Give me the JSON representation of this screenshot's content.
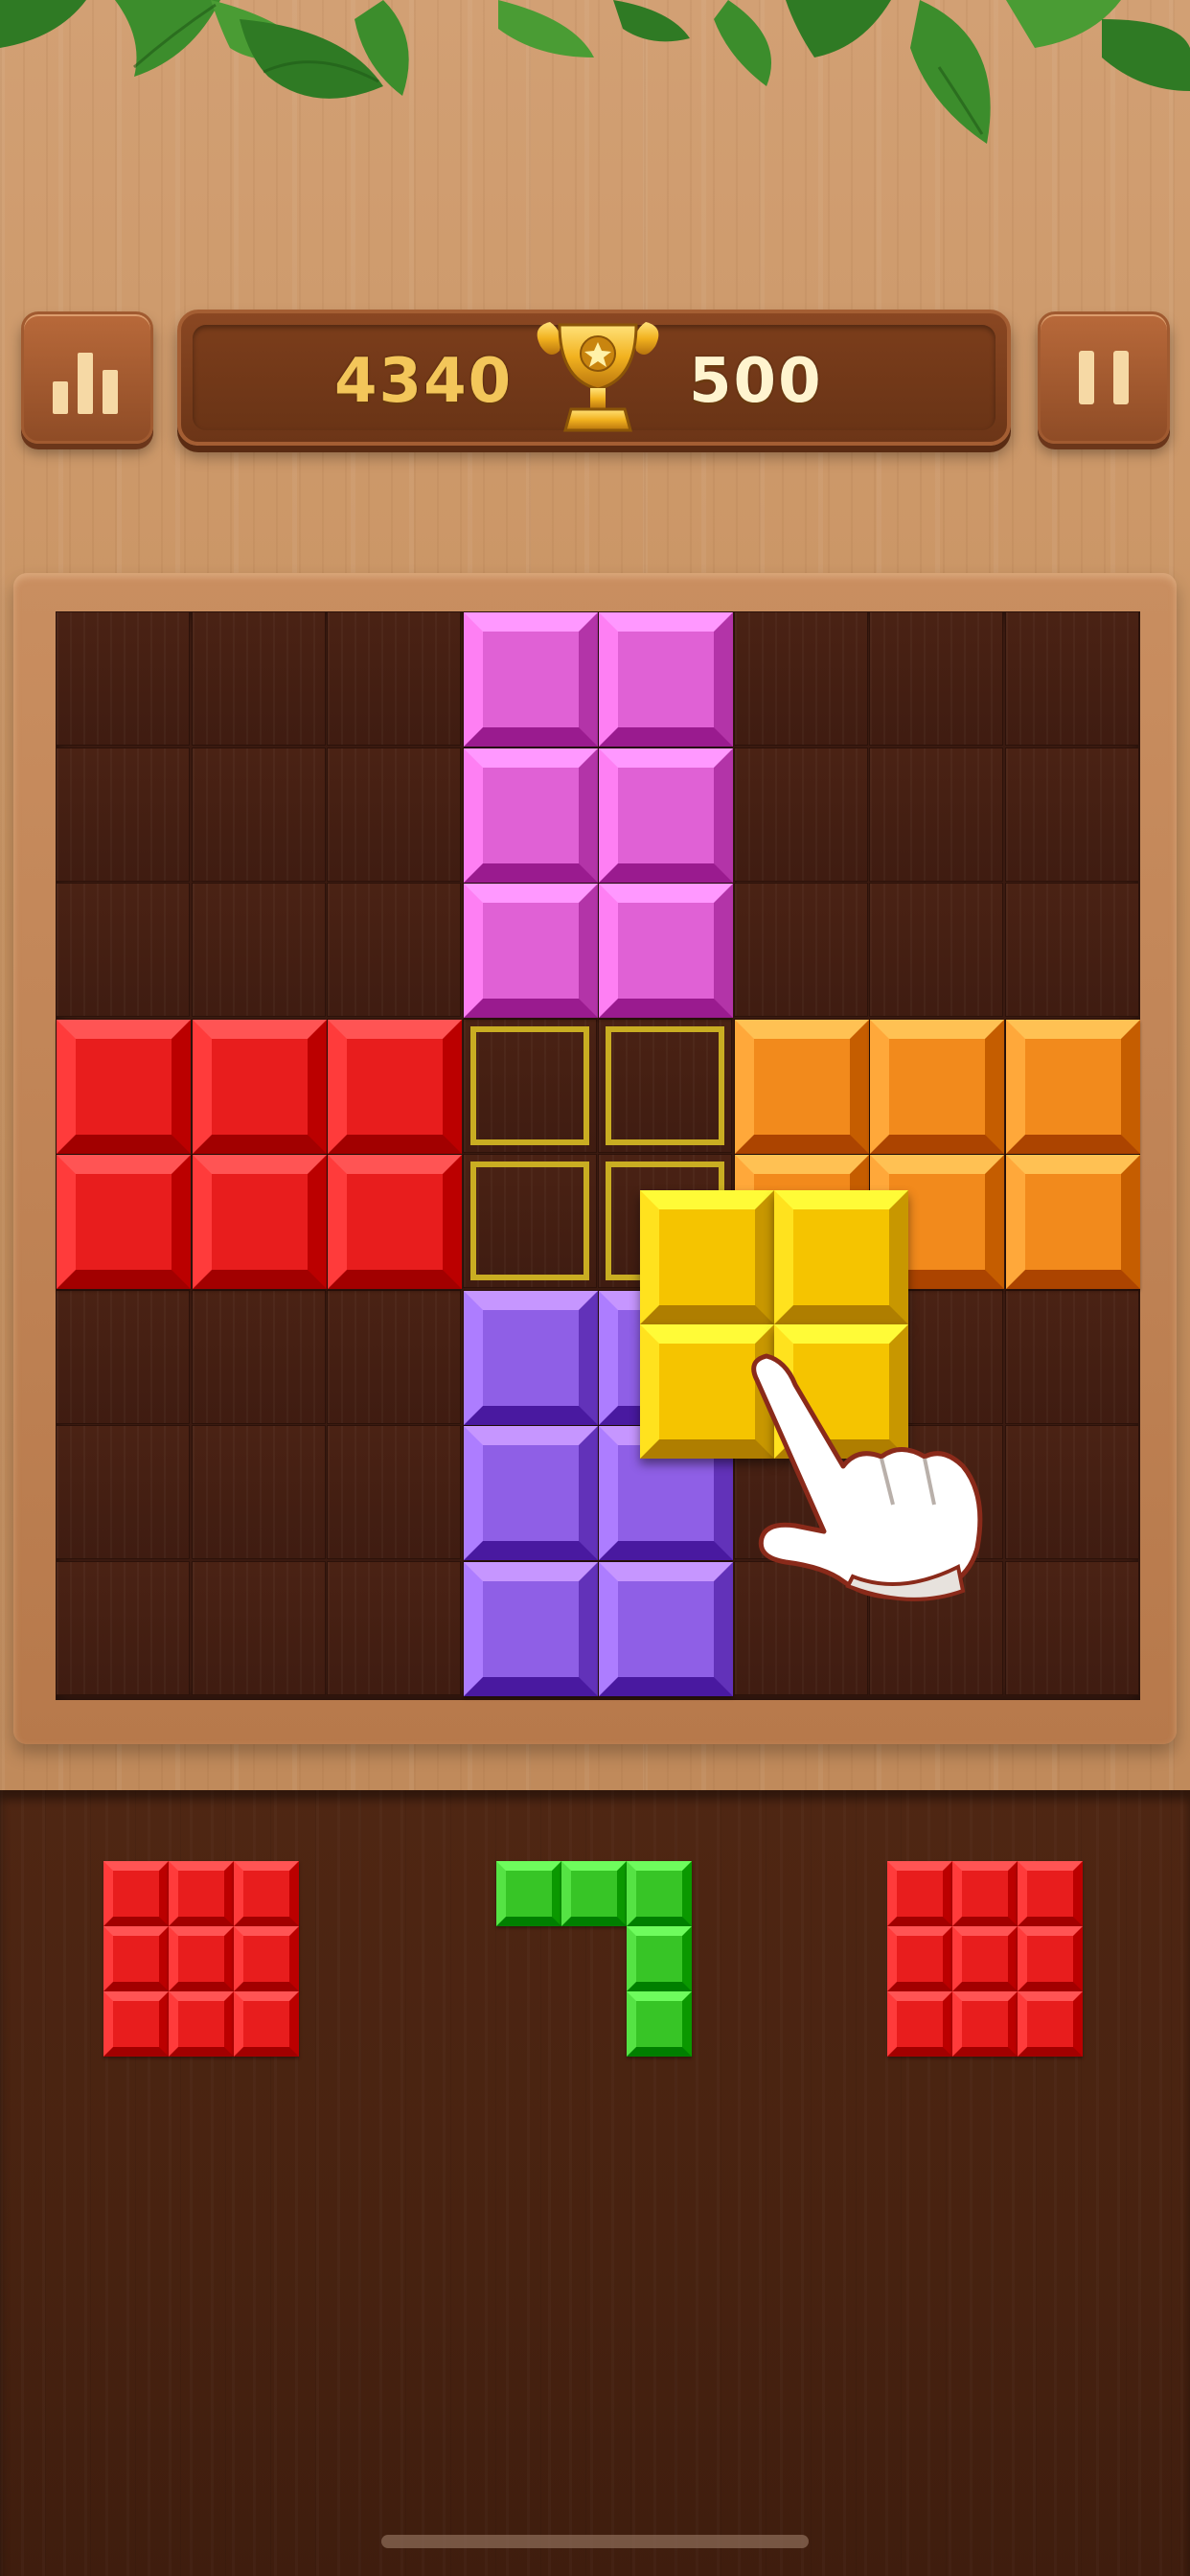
{
  "header": {
    "current_score": "4340",
    "best_score": "500"
  },
  "icons": {
    "stats": "bar-chart-icon",
    "trophy": "trophy-icon",
    "pause": "pause-icon",
    "hand": "pointing-hand-icon"
  },
  "colors": {
    "magenta": "#e061d5",
    "red": "#e81d1d",
    "orange": "#f28a1c",
    "purple": "#8f5fe6",
    "yellow": "#f5c400",
    "green": "#37c526",
    "outline": "#c9ad22"
  },
  "board": {
    "rows": 8,
    "cols": 8,
    "filled": [
      {
        "row": 0,
        "col": 3,
        "color": "magenta"
      },
      {
        "row": 0,
        "col": 4,
        "color": "magenta"
      },
      {
        "row": 1,
        "col": 3,
        "color": "magenta"
      },
      {
        "row": 1,
        "col": 4,
        "color": "magenta"
      },
      {
        "row": 2,
        "col": 3,
        "color": "magenta"
      },
      {
        "row": 2,
        "col": 4,
        "color": "magenta"
      },
      {
        "row": 3,
        "col": 0,
        "color": "red"
      },
      {
        "row": 3,
        "col": 1,
        "color": "red"
      },
      {
        "row": 3,
        "col": 2,
        "color": "red"
      },
      {
        "row": 4,
        "col": 0,
        "color": "red"
      },
      {
        "row": 4,
        "col": 1,
        "color": "red"
      },
      {
        "row": 4,
        "col": 2,
        "color": "red"
      },
      {
        "row": 3,
        "col": 5,
        "color": "orange"
      },
      {
        "row": 3,
        "col": 6,
        "color": "orange"
      },
      {
        "row": 3,
        "col": 7,
        "color": "orange"
      },
      {
        "row": 4,
        "col": 5,
        "color": "orange"
      },
      {
        "row": 4,
        "col": 6,
        "color": "orange"
      },
      {
        "row": 4,
        "col": 7,
        "color": "orange"
      },
      {
        "row": 5,
        "col": 3,
        "color": "purple"
      },
      {
        "row": 5,
        "col": 4,
        "color": "purple"
      },
      {
        "row": 6,
        "col": 3,
        "color": "purple"
      },
      {
        "row": 6,
        "col": 4,
        "color": "purple"
      },
      {
        "row": 7,
        "col": 3,
        "color": "purple"
      },
      {
        "row": 7,
        "col": 4,
        "color": "purple"
      }
    ],
    "target_outline": [
      {
        "row": 3,
        "col": 3
      },
      {
        "row": 3,
        "col": 4
      },
      {
        "row": 4,
        "col": 3
      },
      {
        "row": 4,
        "col": 4
      }
    ],
    "dragging_piece": {
      "color": "yellow",
      "cells": [
        [
          0,
          0
        ],
        [
          0,
          1
        ],
        [
          1,
          0
        ],
        [
          1,
          1
        ]
      ]
    }
  },
  "tray": {
    "pieces": [
      {
        "color": "red",
        "cells": [
          [
            0,
            0
          ],
          [
            0,
            1
          ],
          [
            0,
            2
          ],
          [
            1,
            0
          ],
          [
            1,
            1
          ],
          [
            1,
            2
          ],
          [
            2,
            0
          ],
          [
            2,
            1
          ],
          [
            2,
            2
          ]
        ]
      },
      {
        "color": "green",
        "cells": [
          [
            0,
            0
          ],
          [
            0,
            1
          ],
          [
            0,
            2
          ],
          [
            1,
            2
          ],
          [
            2,
            2
          ]
        ]
      },
      {
        "color": "red",
        "cells": [
          [
            0,
            0
          ],
          [
            0,
            1
          ],
          [
            0,
            2
          ],
          [
            1,
            0
          ],
          [
            1,
            1
          ],
          [
            1,
            2
          ],
          [
            2,
            0
          ],
          [
            2,
            1
          ],
          [
            2,
            2
          ]
        ]
      }
    ]
  }
}
